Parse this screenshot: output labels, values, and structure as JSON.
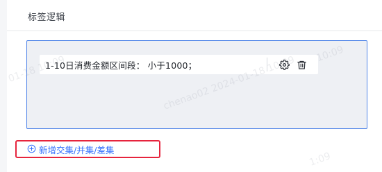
{
  "section": {
    "title": "标签逻辑"
  },
  "condition": {
    "text": "1-10日消费金额区间段： 小于1000；",
    "settings_icon": "gear-icon",
    "delete_icon": "trash-icon"
  },
  "actions": {
    "add_label": "新增交集/并集/差集",
    "add_icon": "plus-circle-icon"
  },
  "watermark": {
    "text_main": "chenao02 2024-01-18 10:09",
    "text_left": "01-18 10:09",
    "text_top_right": "10:09",
    "text_bottom_right": "1:09"
  },
  "colors": {
    "accent": "#3370ff",
    "panel_border": "#4f84e8",
    "panel_bg": "#eef0f4",
    "highlight": "#e6243d"
  }
}
